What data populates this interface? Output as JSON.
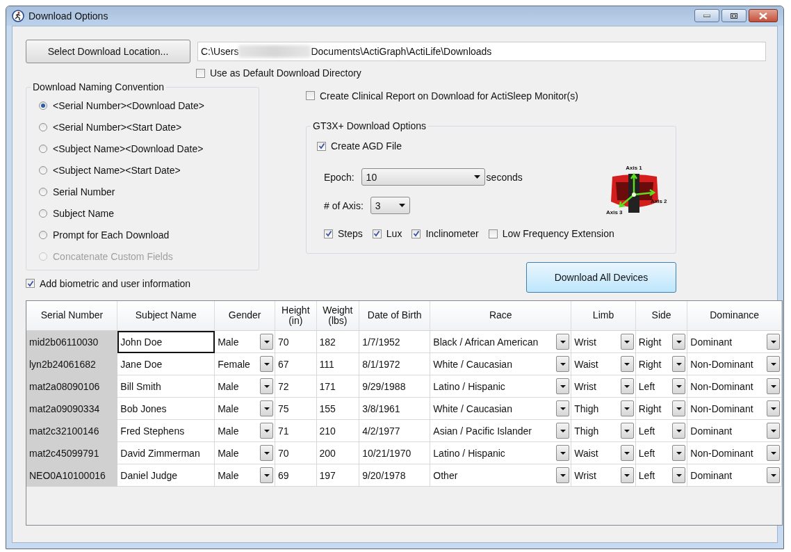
{
  "window": {
    "title": "Download Options"
  },
  "location": {
    "button": "Select Download Location...",
    "path_start": "C:\\Users",
    "path_end": "Documents\\ActiGraph\\ActiLife\\Downloads",
    "default_checkbox": {
      "label": "Use as Default Download Directory",
      "checked": false
    }
  },
  "naming_convention": {
    "title": "Download Naming Convention",
    "options": [
      {
        "label": "<Serial Number><Download Date>",
        "selected": true,
        "disabled": false
      },
      {
        "label": "<Serial Number><Start Date>",
        "selected": false,
        "disabled": false
      },
      {
        "label": "<Subject Name><Download Date>",
        "selected": false,
        "disabled": false
      },
      {
        "label": "<Subject Name><Start Date>",
        "selected": false,
        "disabled": false
      },
      {
        "label": "Serial Number",
        "selected": false,
        "disabled": false
      },
      {
        "label": "Subject Name",
        "selected": false,
        "disabled": false
      },
      {
        "label": "Prompt for Each Download",
        "selected": false,
        "disabled": false
      },
      {
        "label": "Concatenate Custom Fields",
        "selected": false,
        "disabled": true
      }
    ]
  },
  "biometric_checkbox": {
    "label": "Add biometric and user information",
    "checked": true
  },
  "clinical_checkbox": {
    "label": "Create Clinical Report on Download for ActiSleep Monitor(s)",
    "checked": false
  },
  "gt3x": {
    "title": "GT3X+ Download Options",
    "agd_checkbox": {
      "label": "Create AGD File",
      "checked": true
    },
    "epoch": {
      "label": "Epoch:",
      "value": "10",
      "unit": "seconds"
    },
    "axis": {
      "label": "# of Axis:",
      "value": "3"
    },
    "axis_labels": [
      "Axis 1",
      "Axis 2",
      "Axis 3"
    ],
    "options": [
      {
        "label": "Steps",
        "checked": true
      },
      {
        "label": "Lux",
        "checked": true
      },
      {
        "label": "Inclinometer",
        "checked": true
      },
      {
        "label": "Low Frequency Extension",
        "checked": false
      }
    ]
  },
  "download_button": "Download All Devices",
  "table": {
    "columns": [
      {
        "label": "Serial Number",
        "kind": "serial"
      },
      {
        "label": "Subject Name",
        "kind": "input"
      },
      {
        "label": "Gender",
        "kind": "combo"
      },
      {
        "label": "Height (in)",
        "kind": "text"
      },
      {
        "label": "Weight (lbs)",
        "kind": "text"
      },
      {
        "label": "Date of Birth",
        "kind": "text"
      },
      {
        "label": "Race",
        "kind": "combo"
      },
      {
        "label": "Limb",
        "kind": "combo"
      },
      {
        "label": "Side",
        "kind": "combo"
      },
      {
        "label": "Dominance",
        "kind": "combo"
      }
    ],
    "rows": [
      {
        "cells": [
          "mid2b06110030",
          "John Doe",
          "Male",
          "70",
          "182",
          "1/7/1952",
          "Black / African American",
          "Wrist",
          "Right",
          "Dominant"
        ],
        "name_focused": true
      },
      {
        "cells": [
          "lyn2b24061682",
          "Jane Doe",
          "Female",
          "67",
          "111",
          "8/1/1972",
          "White / Caucasian",
          "Waist",
          "Right",
          "Non-Dominant"
        ],
        "name_focused": false
      },
      {
        "cells": [
          "mat2a08090106",
          "Bill Smith",
          "Male",
          "72",
          "171",
          "9/29/1988",
          "Latino / Hispanic",
          "Wrist",
          "Left",
          "Non-Dominant"
        ],
        "name_focused": false
      },
      {
        "cells": [
          "mat2a09090334",
          "Bob Jones",
          "Male",
          "75",
          "155",
          "3/8/1961",
          "White / Caucasian",
          "Thigh",
          "Right",
          "Non-Dominant"
        ],
        "name_focused": false
      },
      {
        "cells": [
          "mat2c32100146",
          "Fred Stephens",
          "Male",
          "71",
          "210",
          "4/2/1977",
          "Asian / Pacific Islander",
          "Thigh",
          "Left",
          "Dominant"
        ],
        "name_focused": false
      },
      {
        "cells": [
          "mat2c45099791",
          "David Zimmerman",
          "Male",
          "70",
          "200",
          "10/21/1970",
          "Latino / Hispanic",
          "Waist",
          "Left",
          "Non-Dominant"
        ],
        "name_focused": false
      },
      {
        "cells": [
          "NEO0A10100016",
          "Daniel Judge",
          "Male",
          "69",
          "197",
          "9/20/1978",
          "Other",
          "Wrist",
          "Left",
          "Dominant"
        ],
        "name_focused": false
      }
    ]
  }
}
